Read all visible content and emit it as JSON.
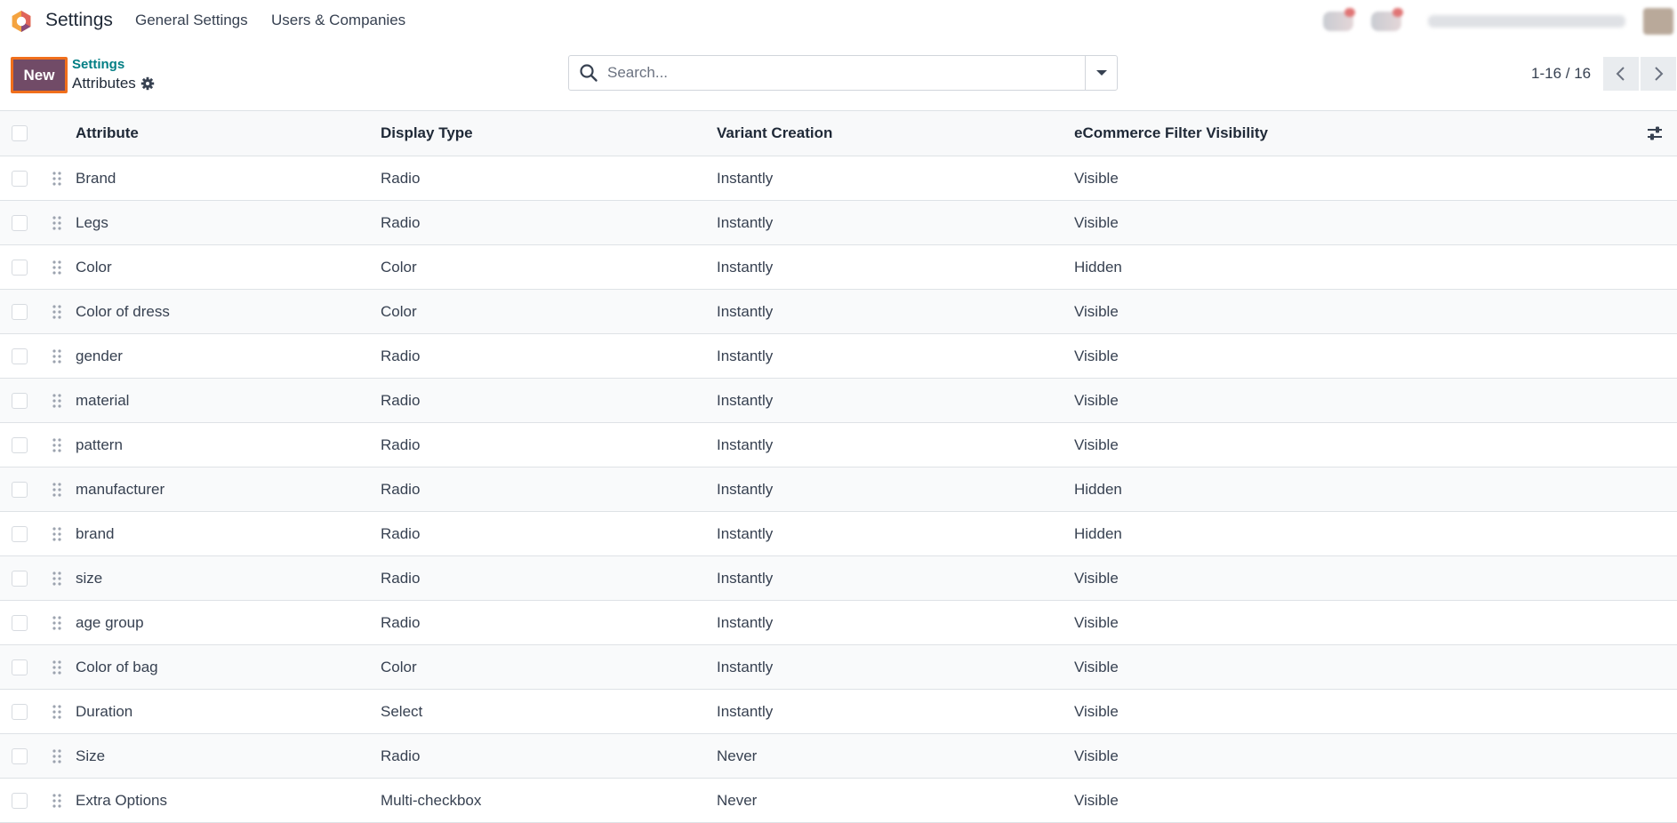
{
  "navbar": {
    "app_name": "Settings",
    "menus": [
      "General Settings",
      "Users & Companies"
    ]
  },
  "control_panel": {
    "new_button": "New",
    "breadcrumb_parent": "Settings",
    "breadcrumb_current": "Attributes",
    "search_placeholder": "Search...",
    "pager": "1-16 / 16"
  },
  "table": {
    "headers": [
      "Attribute",
      "Display Type",
      "Variant Creation",
      "eCommerce Filter Visibility"
    ],
    "rows": [
      [
        "Brand",
        "Radio",
        "Instantly",
        "Visible"
      ],
      [
        "Legs",
        "Radio",
        "Instantly",
        "Visible"
      ],
      [
        "Color",
        "Color",
        "Instantly",
        "Hidden"
      ],
      [
        "Color of dress",
        "Color",
        "Instantly",
        "Visible"
      ],
      [
        "gender",
        "Radio",
        "Instantly",
        "Visible"
      ],
      [
        "material",
        "Radio",
        "Instantly",
        "Visible"
      ],
      [
        "pattern",
        "Radio",
        "Instantly",
        "Visible"
      ],
      [
        "manufacturer",
        "Radio",
        "Instantly",
        "Hidden"
      ],
      [
        "brand",
        "Radio",
        "Instantly",
        "Hidden"
      ],
      [
        "size",
        "Radio",
        "Instantly",
        "Visible"
      ],
      [
        "age group",
        "Radio",
        "Instantly",
        "Visible"
      ],
      [
        "Color of bag",
        "Color",
        "Instantly",
        "Visible"
      ],
      [
        "Duration",
        "Select",
        "Instantly",
        "Visible"
      ],
      [
        "Size",
        "Radio",
        "Never",
        "Visible"
      ],
      [
        "Extra Options",
        "Multi-checkbox",
        "Never",
        "Visible"
      ]
    ]
  },
  "icons": {
    "app_logo": "odoo-logo-icon",
    "breadcrumb": "gear-icon",
    "search": "search-icon",
    "search_toggle": "caret-down-icon",
    "pager_prev": "chevron-left-icon",
    "pager_next": "chevron-right-icon",
    "row_handle": "drag-handle-icon",
    "optional_columns": "sliders-icon"
  },
  "colors": {
    "primary": "#714b67",
    "focus_outline": "#f06f1c",
    "breadcrumb_link": "#017e84"
  }
}
